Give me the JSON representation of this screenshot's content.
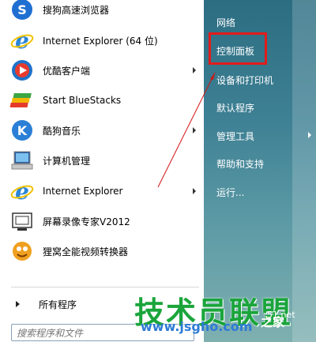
{
  "programs": [
    {
      "label": "搜狗高速浏览器",
      "icon": "sogou-browser-icon"
    },
    {
      "label": "Internet Explorer (64 位)",
      "icon": "internet-explorer-icon"
    },
    {
      "label": "优酷客户端",
      "icon": "youku-icon"
    },
    {
      "label": "Start BlueStacks",
      "icon": "bluestacks-icon"
    },
    {
      "label": "酷狗音乐",
      "icon": "kugou-icon"
    },
    {
      "label": "计算机管理",
      "icon": "computer-management-icon"
    },
    {
      "label": "Internet Explorer",
      "icon": "internet-explorer-icon"
    },
    {
      "label": "屏幕录像专家V2012",
      "icon": "screen-recorder-icon"
    },
    {
      "label": "狸窝全能视频转换器",
      "icon": "video-converter-icon"
    }
  ],
  "all_programs": "所有程序",
  "search": {
    "placeholder": "搜索程序和文件"
  },
  "right_items": [
    {
      "label": "网络"
    },
    {
      "label": "控制面板"
    },
    {
      "label": "设备和打印机"
    },
    {
      "label": "默认程序"
    },
    {
      "label": "管理工具"
    },
    {
      "label": "帮助和支持"
    },
    {
      "label": "运行..."
    }
  ],
  "watermark": {
    "text": "技术员联盟",
    "url": "www.jsgho.com",
    "tail": "之家",
    "small": "51.net"
  },
  "colors": {
    "highlight": "#e21b1b",
    "watermark_green": "#1aa53b"
  }
}
